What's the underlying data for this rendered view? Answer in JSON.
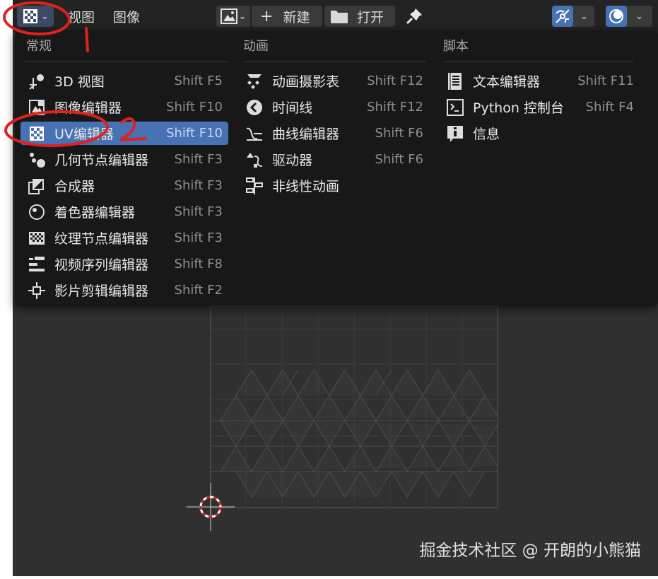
{
  "header": {
    "menus": [
      "视图",
      "图像"
    ],
    "new_label": "新建",
    "open_label": "打开"
  },
  "dropdown": {
    "columns": [
      {
        "title": "常规",
        "items": [
          {
            "label": "3D 视图",
            "shortcut": "Shift F5",
            "icon": "3d-viewport-icon"
          },
          {
            "label": "图像编辑器",
            "shortcut": "Shift F10",
            "icon": "image-editor-icon"
          },
          {
            "label": "UV编辑器",
            "shortcut": "Shift F10",
            "icon": "uv-editor-icon",
            "active": true
          },
          {
            "label": "几何节点编辑器",
            "shortcut": "Shift F3",
            "icon": "geometry-nodes-icon"
          },
          {
            "label": "合成器",
            "shortcut": "Shift F3",
            "icon": "compositor-icon"
          },
          {
            "label": "着色器编辑器",
            "shortcut": "Shift F3",
            "icon": "shader-editor-icon"
          },
          {
            "label": "纹理节点编辑器",
            "shortcut": "Shift F3",
            "icon": "texture-nodes-icon"
          },
          {
            "label": "视频序列编辑器",
            "shortcut": "Shift F8",
            "icon": "sequencer-icon"
          },
          {
            "label": "影片剪辑编辑器",
            "shortcut": "Shift F2",
            "icon": "movie-clip-icon"
          }
        ]
      },
      {
        "title": "动画",
        "items": [
          {
            "label": "动画摄影表",
            "shortcut": "Shift F12",
            "icon": "dope-sheet-icon"
          },
          {
            "label": "时间线",
            "shortcut": "Shift F12",
            "icon": "timeline-icon"
          },
          {
            "label": "曲线编辑器",
            "shortcut": "Shift F6",
            "icon": "graph-editor-icon"
          },
          {
            "label": "驱动器",
            "shortcut": "Shift F6",
            "icon": "drivers-icon"
          },
          {
            "label": "非线性动画",
            "shortcut": "",
            "icon": "nla-icon"
          }
        ]
      },
      {
        "title": "脚本",
        "items": [
          {
            "label": "文本编辑器",
            "shortcut": "Shift F11",
            "icon": "text-editor-icon"
          },
          {
            "label": "Python 控制台",
            "shortcut": "Shift F4",
            "icon": "python-console-icon"
          },
          {
            "label": "信息",
            "shortcut": "",
            "icon": "info-icon"
          }
        ]
      }
    ]
  },
  "annotations": [
    "1",
    "2"
  ],
  "watermark": "掘金技术社区 @ 开朗的小熊猫",
  "colors": {
    "accent": "#4772b3",
    "header": "#232323",
    "menu_bg": "#181818",
    "viewport": "#303030",
    "annotation": "#e0201c"
  }
}
